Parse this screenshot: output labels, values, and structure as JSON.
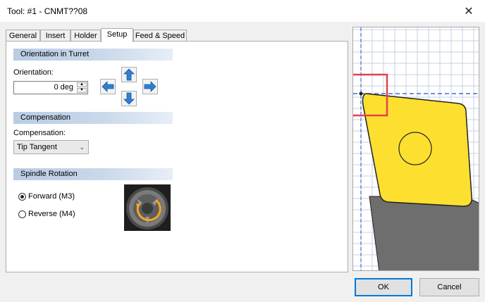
{
  "window": {
    "title": "Tool: #1 - CNMT??08",
    "close_glyph": "✕"
  },
  "tabs": [
    {
      "label": "General"
    },
    {
      "label": "Insert"
    },
    {
      "label": "Holder"
    },
    {
      "label": "Setup",
      "active": true
    },
    {
      "label": "Feed & Speed"
    }
  ],
  "orientation_section": {
    "header": "Orientation in Turret",
    "label": "Orientation:",
    "value": "0 deg",
    "arrows": [
      "up-arrow-icon",
      "left-arrow-icon",
      "right-arrow-icon",
      "down-arrow-icon"
    ]
  },
  "compensation_section": {
    "header": "Compensation",
    "label": "Compensation:",
    "selected": "Tip Tangent"
  },
  "spindle_section": {
    "header": "Spindle Rotation",
    "options": [
      {
        "label": "Forward (M3)",
        "checked": true
      },
      {
        "label": "Reverse (M4)",
        "checked": false
      }
    ],
    "icon": "spindle-rotation-icon"
  },
  "buttons": {
    "ok": "OK",
    "cancel": "Cancel"
  },
  "colors": {
    "insert_fill": "#fde02f",
    "holder_fill": "#6e6e6e",
    "grid_line": "#c8d2e6",
    "axis_dash": "#3b6fd1",
    "highlight_box": "#e0444a",
    "rotation_arrow": "#f5a623",
    "arrow_blue": "#2f7fd0"
  }
}
